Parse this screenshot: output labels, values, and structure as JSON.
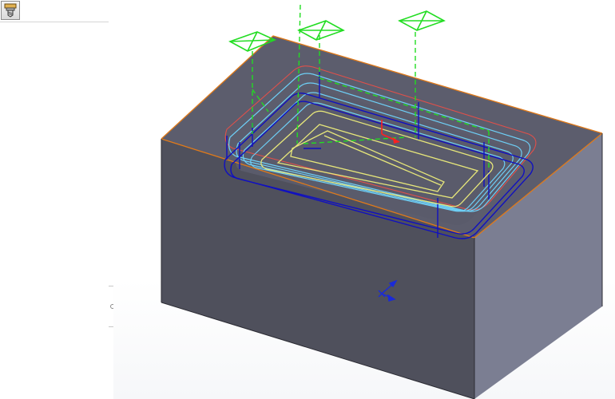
{
  "app": {
    "panel": {
      "tool_icon": "end-mill-tool-icon"
    },
    "viewport": {
      "part": "rectangular-block-with-pocket",
      "toolpath": "pocket-milling-toolpath",
      "triad": "coordinate-triad-icon"
    }
  },
  "colors": {
    "block_front": "#4f505c",
    "block_right": "#797c8f",
    "block_top": "#5f6070",
    "edge_orange": "#e07a1a",
    "toolpath_cyan": "#6ecff6",
    "toolpath_blue": "#1010c0",
    "toolpath_yellow": "#e6e67a",
    "rapid_green": "#22dd22",
    "axis_red": "#ff2020"
  }
}
